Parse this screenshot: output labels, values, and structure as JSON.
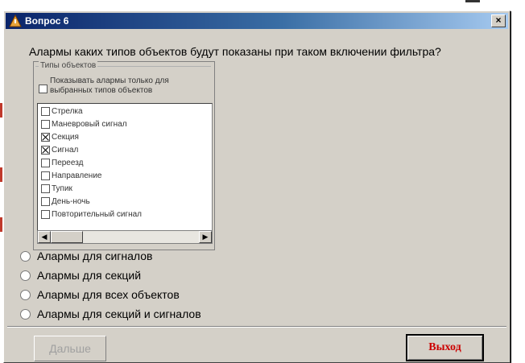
{
  "window": {
    "title": "Вопрос 6",
    "close_glyph": "×"
  },
  "question": "Алармы каких типов объектов будут показаны при таком включении фильтра?",
  "filter_panel": {
    "group_label": "Типы объектов",
    "show_only_label": "Показывать алармы только для выбранных типов объектов",
    "show_only_checked": false,
    "types": [
      {
        "label": "Стрелка",
        "checked": false
      },
      {
        "label": "Маневровый сигнал",
        "checked": false
      },
      {
        "label": "Секция",
        "checked": true
      },
      {
        "label": "Сигнал",
        "checked": true
      },
      {
        "label": "Переезд",
        "checked": false
      },
      {
        "label": "Направление",
        "checked": false
      },
      {
        "label": "Тупик",
        "checked": false
      },
      {
        "label": "День-ночь",
        "checked": false
      },
      {
        "label": "Повторительный сигнал",
        "checked": false
      }
    ],
    "scroll_left": "◀",
    "scroll_right": "▶"
  },
  "answers": [
    "Алармы для сигналов",
    "Алармы для секций",
    "Алармы для всех объектов",
    "Алармы для секций и сигналов"
  ],
  "buttons": {
    "next": "Дальше",
    "exit": "Выход"
  },
  "colors": {
    "titlebar_start": "#0a246a",
    "dialog_bg": "#d4d0c8",
    "exit_text": "#cc0000"
  }
}
